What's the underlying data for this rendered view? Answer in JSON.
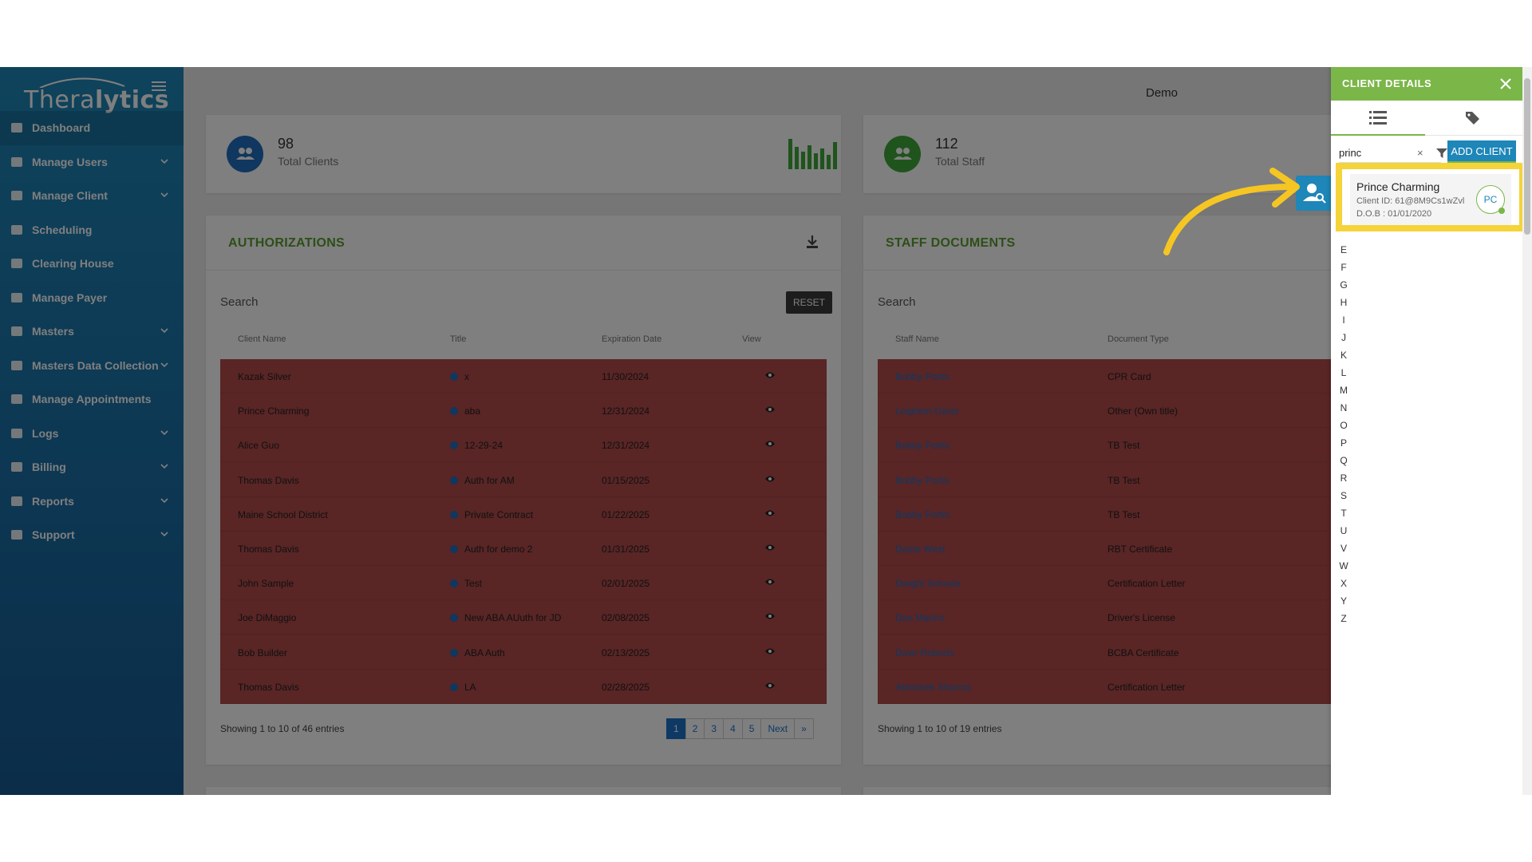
{
  "app": {
    "brand_light": "Thera",
    "brand_bold": "lytics",
    "workspace": "Demo"
  },
  "sidebar": {
    "items": [
      {
        "label": "Dashboard",
        "icon": "dashboard-icon"
      },
      {
        "label": "Manage Users",
        "icon": "users-icon"
      },
      {
        "label": "Manage Client",
        "icon": "user-icon"
      },
      {
        "label": "Scheduling",
        "icon": "calendar-icon"
      },
      {
        "label": "Clearing House",
        "icon": "id-card-icon"
      },
      {
        "label": "Manage Payer",
        "icon": "payer-icon"
      },
      {
        "label": "Masters",
        "icon": "database-icon"
      },
      {
        "label": "Masters Data Collection",
        "icon": "database-icon"
      },
      {
        "label": "Manage Appointments",
        "icon": "appointment-icon"
      },
      {
        "label": "Logs",
        "icon": "history-icon"
      },
      {
        "label": "Billing",
        "icon": "dollar-icon"
      },
      {
        "label": "Reports",
        "icon": "report-icon"
      },
      {
        "label": "Support",
        "icon": "help-icon"
      }
    ]
  },
  "stats": {
    "clients": {
      "value": "98",
      "label": "Total Clients"
    },
    "staff": {
      "value": "112",
      "label": "Total Staff"
    }
  },
  "authorizations": {
    "title": "AUTHORIZATIONS",
    "search_label": "Search",
    "reset_label": "RESET",
    "columns": [
      "Client Name",
      "Title",
      "Expiration Date",
      "View"
    ],
    "rows": [
      {
        "client": "Kazak Silver",
        "title": "x",
        "date": "11/30/2024"
      },
      {
        "client": "Prince Charming",
        "title": "aba",
        "date": "12/31/2024"
      },
      {
        "client": "Alice Guo",
        "title": "12-29-24",
        "date": "12/31/2024"
      },
      {
        "client": "Thomas Davis",
        "title": "Auth for AM",
        "date": "01/15/2025"
      },
      {
        "client": "Maine School District",
        "title": "Private Contract",
        "date": "01/22/2025"
      },
      {
        "client": "Thomas Davis",
        "title": "Auth for demo 2",
        "date": "01/31/2025"
      },
      {
        "client": "John Sample",
        "title": "Test",
        "date": "02/01/2025"
      },
      {
        "client": "Joe DiMaggio",
        "title": "New ABA AUuth for JD",
        "date": "02/08/2025"
      },
      {
        "client": "Bob Builder",
        "title": "ABA Auth",
        "date": "02/13/2025"
      },
      {
        "client": "Thomas Davis",
        "title": "LA",
        "date": "02/28/2025"
      }
    ],
    "showing": "Showing 1 to 10 of 46 entries",
    "pages": [
      "1",
      "2",
      "3",
      "4",
      "5",
      "Next",
      "»"
    ]
  },
  "staff_documents": {
    "title": "STAFF DOCUMENTS",
    "search_label": "Search",
    "columns": [
      "Staff Name",
      "Document Type"
    ],
    "rows": [
      {
        "staff": "Bobby Portis",
        "doc": "CPR Card"
      },
      {
        "staff": "Leighton Davis",
        "doc": "Other (Own title)"
      },
      {
        "staff": "Bobby Portis",
        "doc": "TB Test"
      },
      {
        "staff": "Bobby Portis",
        "doc": "TB Test"
      },
      {
        "staff": "Bobby Portis",
        "doc": "TB Test"
      },
      {
        "staff": "Dante West",
        "doc": "RBT Certificate"
      },
      {
        "staff": "Dwight Schrute",
        "doc": "Certification Letter"
      },
      {
        "staff": "Dan Marino",
        "doc": "Driver's License"
      },
      {
        "staff": "Dave Roberts",
        "doc": "BCBA Certificate"
      },
      {
        "staff": "Abhishek Sharma",
        "doc": "Certification Letter"
      }
    ],
    "showing": "Showing 1 to 10 of 19 entries"
  },
  "client_panel": {
    "title": "CLIENT DETAILS",
    "search_value": "princ",
    "clear_label": "×",
    "add_client_label": "ADD CLIENT",
    "result": {
      "name": "Prince Charming",
      "client_id": "Client ID: 61@8M9Cs1wZvl",
      "dob": "D.O.B : 01/01/2020",
      "initials": "PC"
    },
    "letters": [
      "E",
      "F",
      "G",
      "H",
      "I",
      "J",
      "K",
      "L",
      "M",
      "N",
      "O",
      "P",
      "Q",
      "R",
      "S",
      "T",
      "U",
      "V",
      "W",
      "X",
      "Y",
      "Z"
    ]
  },
  "colors": {
    "sidebar": "#1e86b8",
    "accent_green": "#7ab648",
    "highlight": "#f5d33a",
    "row_alert": "#b34a4a",
    "link": "#1a73c8"
  }
}
